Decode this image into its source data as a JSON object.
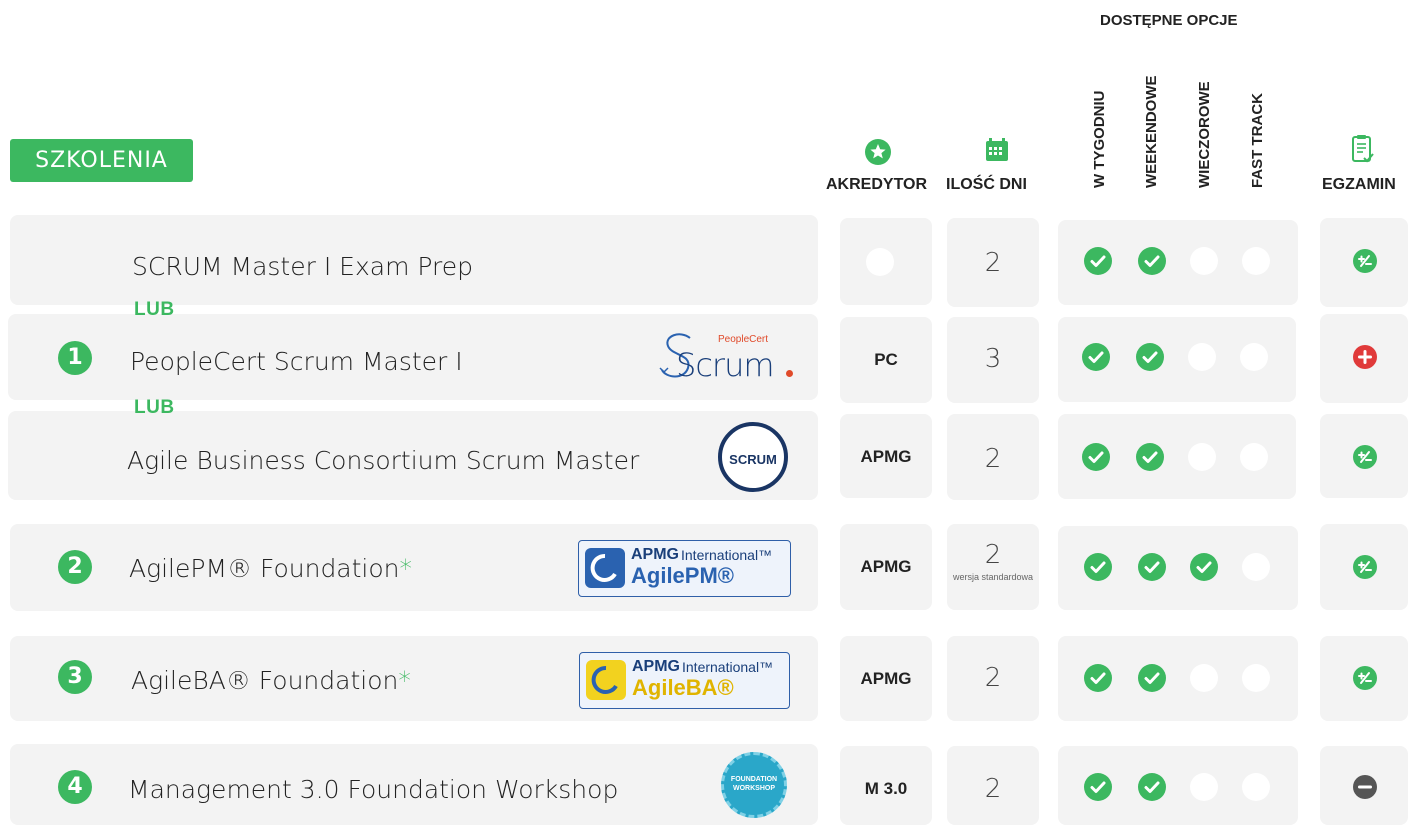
{
  "header": {
    "section_label": "SZKOLENIA",
    "options_title": "DOSTĘPNE OPCJE",
    "accreditor": "AKREDYTOR",
    "days": "ILOŚĆ DNI",
    "exam": "EGZAMIN",
    "options": [
      "W TYGODNIU",
      "WEEKENDOWE",
      "WIECZOROWE",
      "FAST TRACK"
    ]
  },
  "or_label": "LUB",
  "footnote_mark": "*",
  "logos": {
    "peoplecert_small": "PeopleCert",
    "peoplecert_main": "Scrum",
    "abc_badge": "SCRUM",
    "apmg_brand": "APMG",
    "apmg_international": "International™",
    "agilepm": "AgilePM®",
    "agileba": "AgileBA®",
    "m30_badge": "FOUNDATION WORKSHOP"
  },
  "rows": [
    {
      "number": "",
      "title": "SCRUM Master I Exam Prep",
      "accreditor": "",
      "days": "2",
      "days_note": "",
      "options": [
        true,
        true,
        false,
        false
      ],
      "exam": "partial"
    },
    {
      "number": "1",
      "title": "PeopleCert Scrum Master I",
      "accreditor": "PC",
      "days": "3",
      "days_note": "",
      "options": [
        true,
        true,
        false,
        false
      ],
      "exam": "included"
    },
    {
      "number": "",
      "title": "Agile Business Consortium Scrum Master",
      "accreditor": "APMG",
      "days": "2",
      "days_note": "",
      "options": [
        true,
        true,
        false,
        false
      ],
      "exam": "partial"
    },
    {
      "number": "2",
      "title": "AgilePM® Foundation",
      "accreditor": "APMG",
      "days": "2",
      "days_note": "wersja standardowa",
      "options": [
        true,
        true,
        true,
        false
      ],
      "exam": "partial"
    },
    {
      "number": "3",
      "title": "AgileBA® Foundation",
      "accreditor": "APMG",
      "days": "2",
      "days_note": "",
      "options": [
        true,
        true,
        false,
        false
      ],
      "exam": "partial"
    },
    {
      "number": "4",
      "title": "Management 3.0 Foundation Workshop",
      "accreditor": "M 3.0",
      "days": "2",
      "days_note": "",
      "options": [
        true,
        true,
        false,
        false
      ],
      "exam": "none"
    }
  ],
  "colors": {
    "green": "#3cb860",
    "red": "#e03a3a",
    "gray_row": "#f3f3f3",
    "dark_gray": "#555555"
  },
  "icons": {
    "accreditor": "star-badge-icon",
    "days": "calendar-icon",
    "exam": "clipboard-check-icon"
  }
}
